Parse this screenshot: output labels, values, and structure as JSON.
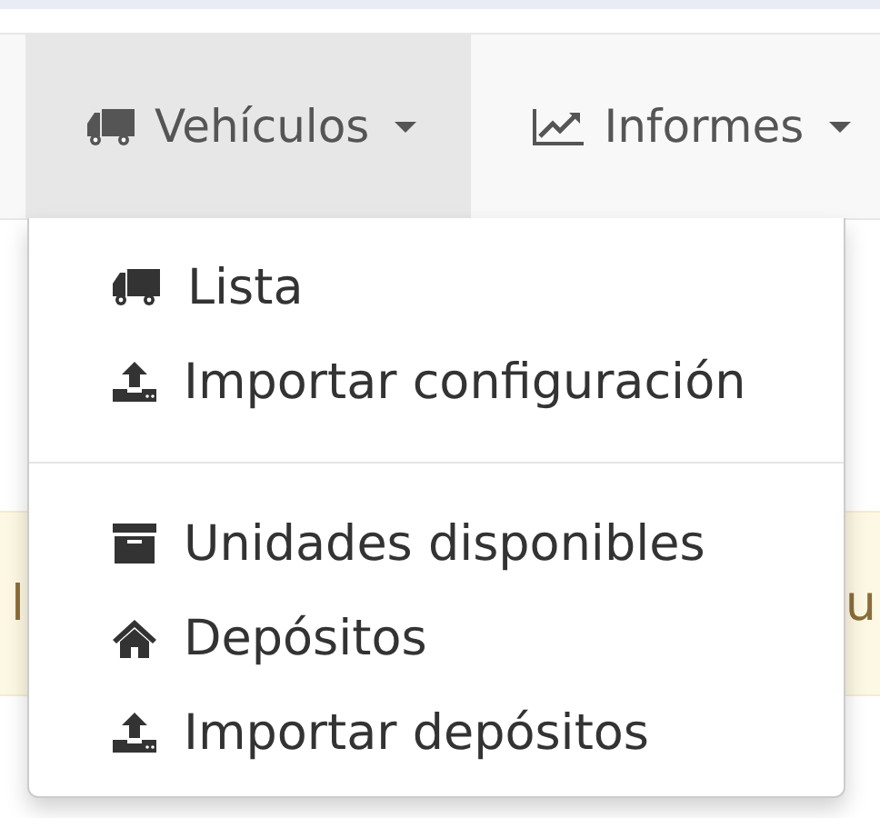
{
  "nav": {
    "items": [
      {
        "label": "Vehículos",
        "kind": "truck",
        "selected": true
      },
      {
        "label": "Informes",
        "kind": "chart",
        "selected": false
      }
    ]
  },
  "alert": {
    "left_fragment": "l",
    "right_fragment": "u"
  },
  "dropdown": {
    "open": true,
    "groups": [
      [
        {
          "label": "Lista",
          "kind": "truck"
        },
        {
          "label": "Importar configuración",
          "kind": "upload"
        }
      ],
      [
        {
          "label": "Unidades disponibles",
          "kind": "archive"
        },
        {
          "label": "Depósitos",
          "kind": "home"
        },
        {
          "label": "Importar depósitos",
          "kind": "upload"
        }
      ]
    ]
  }
}
